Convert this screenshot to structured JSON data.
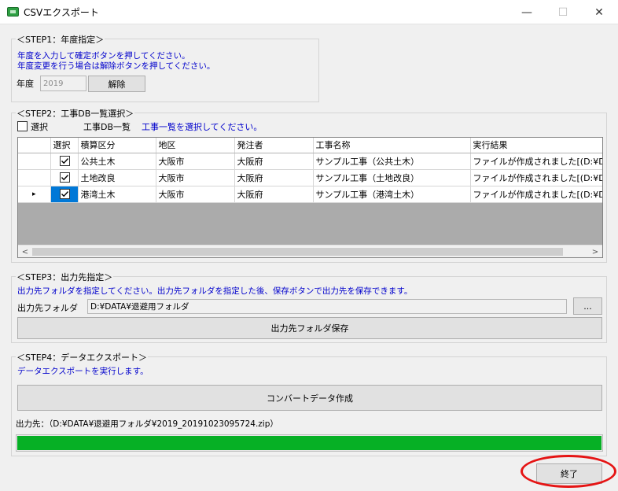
{
  "window": {
    "title": "CSVエクスポート",
    "minimize": "—",
    "maximize": "☐",
    "close": "✕"
  },
  "step1": {
    "label": "＜STEP1：年度指定＞",
    "note1": "年度を入力して確定ボタンを押してください。",
    "note2": "年度変更を行う場合は解除ボタンを押してください。",
    "year_label": "年度",
    "year_value": "2019",
    "unlock_button": "解除"
  },
  "step2": {
    "label": "＜STEP2：工事DB一覧選択＞",
    "select_all_label": "選択",
    "list_label": "工事DB一覧",
    "list_note": "工事一覧を選択してください。",
    "columns": [
      "選択",
      "積算区分",
      "地区",
      "発注者",
      "工事名称",
      "実行結果"
    ],
    "rows": [
      {
        "checked": true,
        "category": "公共土木",
        "district": "大阪市",
        "orderer": "大阪府",
        "name": "サンプル工事（公共土木）",
        "result": "ファイルが作成されました[(D:¥DATA"
      },
      {
        "checked": true,
        "category": "土地改良",
        "district": "大阪市",
        "orderer": "大阪府",
        "name": "サンプル工事（土地改良）",
        "result": "ファイルが作成されました[(D:¥DATA"
      },
      {
        "checked": true,
        "category": "港湾土木",
        "district": "大阪市",
        "orderer": "大阪府",
        "name": "サンプル工事（港湾土木）",
        "result": "ファイルが作成されました[(D:¥DATA"
      }
    ],
    "current_row_marker": "▸",
    "scroll_left": "<",
    "scroll_right": ">"
  },
  "step3": {
    "label": "＜STEP3：出力先指定＞",
    "note": "出力先フォルダを指定してください。出力先フォルダを指定した後、保存ボタンで出力先を保存できます。",
    "folder_label": "出力先フォルダ",
    "folder_value": "D:¥DATA¥退避用フォルダ",
    "browse_button": "...",
    "save_button": "出力先フォルダ保存"
  },
  "step4": {
    "label": "＜STEP4：データエクスポート＞",
    "note": "データエクスポートを実行します。",
    "convert_button": "コンバートデータ作成",
    "output_path": "出力先：（D:¥DATA¥退避用フォルダ¥2019_20191023095724.zip）",
    "progress": 1.0
  },
  "exit_button": "終了",
  "colors": {
    "progress": "#06b025",
    "note": "#0000cc",
    "highlight_oval": "#e51414",
    "selected_cell": "#0078d7"
  }
}
